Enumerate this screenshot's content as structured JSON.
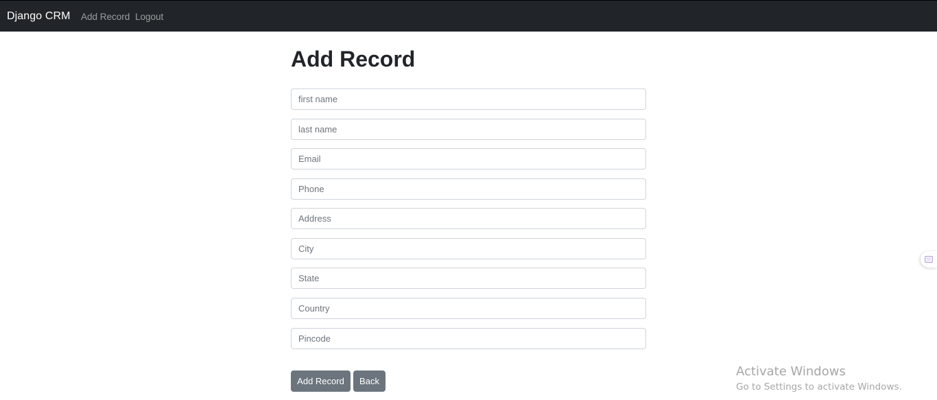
{
  "navbar": {
    "brand": "Django CRM",
    "links": [
      {
        "label": "Add Record"
      },
      {
        "label": "Logout"
      }
    ]
  },
  "page": {
    "title": "Add Record"
  },
  "form": {
    "fields": [
      {
        "placeholder": "first name",
        "value": ""
      },
      {
        "placeholder": "last name",
        "value": ""
      },
      {
        "placeholder": "Email",
        "value": ""
      },
      {
        "placeholder": "Phone",
        "value": ""
      },
      {
        "placeholder": "Address",
        "value": ""
      },
      {
        "placeholder": "City",
        "value": ""
      },
      {
        "placeholder": "State",
        "value": ""
      },
      {
        "placeholder": "Country",
        "value": ""
      },
      {
        "placeholder": "Pincode",
        "value": ""
      }
    ],
    "submit_label": "Add Record",
    "back_label": "Back"
  },
  "watermark": {
    "title": "Activate Windows",
    "subtitle": "Go to Settings to activate Windows."
  },
  "side_tab": {
    "icon": "extension-icon",
    "icon_glyph": "⋅.⋅"
  },
  "colors": {
    "navbar_bg": "#212529",
    "button_bg": "#6c757d",
    "input_border": "#ced4da"
  }
}
